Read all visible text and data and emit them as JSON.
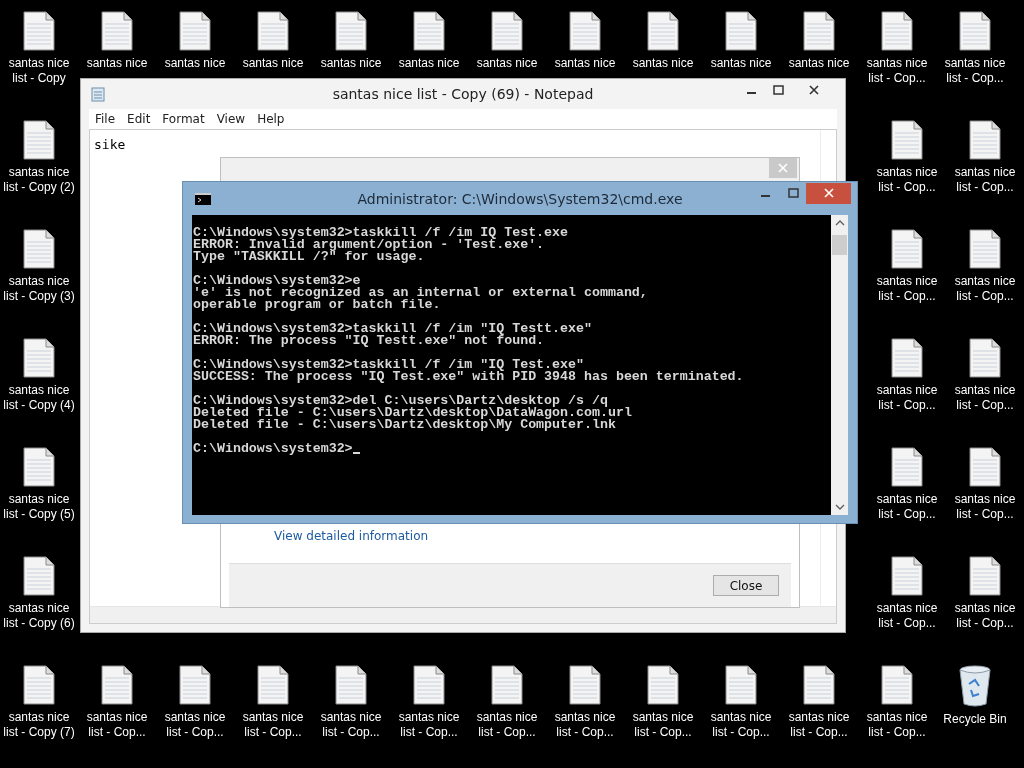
{
  "desktop": {
    "rows": [
      {
        "left": [
          {
            "kind": "file",
            "label": "santas nice list - Copy"
          },
          {
            "kind": "file",
            "label": "santas nice"
          },
          {
            "kind": "file",
            "label": "santas nice"
          },
          {
            "kind": "file",
            "label": "santas nice"
          },
          {
            "kind": "file",
            "label": "santas nice"
          },
          {
            "kind": "file",
            "label": "santas nice"
          },
          {
            "kind": "file",
            "label": "santas nice"
          },
          {
            "kind": "file",
            "label": "santas nice"
          },
          {
            "kind": "file",
            "label": "santas nice"
          },
          {
            "kind": "file",
            "label": "santas nice"
          },
          {
            "kind": "file",
            "label": "santas nice"
          },
          {
            "kind": "file",
            "label": "santas nice list - Cop..."
          },
          {
            "kind": "file",
            "label": "santas nice list - Cop..."
          }
        ],
        "right": []
      },
      {
        "left": [
          {
            "kind": "file",
            "label": "santas nice list - Copy (2)"
          }
        ],
        "right": [
          {
            "kind": "file",
            "label": "santas nice list - Cop..."
          },
          {
            "kind": "file",
            "label": "santas nice list - Cop..."
          }
        ]
      },
      {
        "left": [
          {
            "kind": "file",
            "label": "santas nice list - Copy (3)"
          }
        ],
        "right": [
          {
            "kind": "file",
            "label": "santas nice list - Cop..."
          },
          {
            "kind": "file",
            "label": "santas nice list - Cop..."
          }
        ]
      },
      {
        "left": [
          {
            "kind": "file",
            "label": "santas nice list - Copy (4)"
          }
        ],
        "right": [
          {
            "kind": "file",
            "label": "santas nice list - Cop..."
          },
          {
            "kind": "file",
            "label": "santas nice list - Cop..."
          }
        ]
      },
      {
        "left": [
          {
            "kind": "file",
            "label": "santas nice list - Copy (5)"
          }
        ],
        "right": [
          {
            "kind": "file",
            "label": "santas nice list - Cop..."
          },
          {
            "kind": "file",
            "label": "santas nice list - Cop..."
          }
        ]
      },
      {
        "left": [
          {
            "kind": "file",
            "label": "santas nice list - Copy (6)"
          }
        ],
        "right": [
          {
            "kind": "file",
            "label": "santas nice list - Cop..."
          },
          {
            "kind": "file",
            "label": "santas nice list - Cop..."
          }
        ]
      },
      {
        "left": [
          {
            "kind": "file",
            "label": "santas nice list - Copy (7)"
          },
          {
            "kind": "file",
            "label": "santas nice list - Cop..."
          },
          {
            "kind": "file",
            "label": "santas nice list - Cop..."
          },
          {
            "kind": "file",
            "label": "santas nice list - Cop..."
          },
          {
            "kind": "file",
            "label": "santas nice list - Cop..."
          },
          {
            "kind": "file",
            "label": "santas nice list - Cop..."
          },
          {
            "kind": "file",
            "label": "santas nice list - Cop..."
          },
          {
            "kind": "file",
            "label": "santas nice list - Cop..."
          },
          {
            "kind": "file",
            "label": "santas nice list - Cop..."
          },
          {
            "kind": "file",
            "label": "santas nice list - Cop..."
          },
          {
            "kind": "file",
            "label": "santas nice list - Cop..."
          },
          {
            "kind": "file",
            "label": "santas nice list - Cop..."
          },
          {
            "kind": "recycle_bin",
            "label": "Recycle Bin"
          }
        ],
        "right": []
      }
    ]
  },
  "notepad": {
    "title": "santas nice list - Copy (69) - Notepad",
    "menu": [
      "File",
      "Edit",
      "Format",
      "View",
      "Help"
    ],
    "text": "sike"
  },
  "dialog": {
    "link": "View detailed information",
    "button": "Close"
  },
  "cmd": {
    "title": "Administrator: C:\\Windows\\System32\\cmd.exe",
    "cursor": true,
    "blocks": [
      [
        "C:\\Windows\\system32>taskkill /f /im IQ Test.exe",
        "ERROR: Invalid argument/option - 'Test.exe'.",
        "Type \"TASKKILL /?\" for usage."
      ],
      [
        "C:\\Windows\\system32>e",
        "'e' is not recognized as an internal or external command,",
        "operable program or batch file."
      ],
      [
        "C:\\Windows\\system32>taskkill /f /im \"IQ Testt.exe\"",
        "ERROR: The process \"IQ Testt.exe\" not found."
      ],
      [
        "C:\\Windows\\system32>taskkill /f /im \"IQ Test.exe\"",
        "SUCCESS: The process \"IQ Test.exe\" with PID 3948 has been terminated."
      ],
      [
        "C:\\Windows\\system32>del C:\\users\\Dartz\\desktop /s /q",
        "Deleted file - C:\\users\\Dartz\\desktop\\DataWagon.com.url",
        "Deleted file - C:\\users\\Dartz\\desktop\\My Computer.lnk"
      ],
      [
        "C:\\Windows\\system32>"
      ]
    ]
  }
}
